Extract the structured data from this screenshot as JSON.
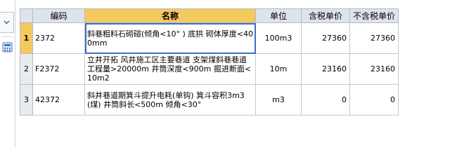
{
  "columns": {
    "code": "编码",
    "name": "名称",
    "unit": "单位",
    "price_tax": "含税单价",
    "price_notax": "不含税单价"
  },
  "rows": [
    {
      "num": "1",
      "code": "2372",
      "name": "斜巷粗料石砌碹(倾角<10°  ) 底拱 砌体厚度<400mm",
      "unit": "100m3",
      "price_tax": "27360",
      "price_notax": "27360"
    },
    {
      "num": "2",
      "code": "F2372",
      "name": "立井开拓 风井施工区主要巷道 支架煤斜巷巷道工程量>20000m 井筒深度<900m 掘进断面<10m2",
      "unit": "10m",
      "price_tax": "23160",
      "price_notax": "23160"
    },
    {
      "num": "3",
      "code": "42372",
      "name": "斜井巷道期箕斗提升电耗(单钩) 箕斗容积3m3 (煤) 井筒斜长<500m 倾角<30°",
      "unit": "m3",
      "price_tax": "0",
      "price_notax": "0"
    }
  ],
  "icons": {
    "dropdown": "chevron-down-icon",
    "tool": "calculator-icon"
  },
  "colors": {
    "active_header": "#f4c95e",
    "header_bg": "#dfe3ea",
    "selection": "#3d6fc9"
  }
}
